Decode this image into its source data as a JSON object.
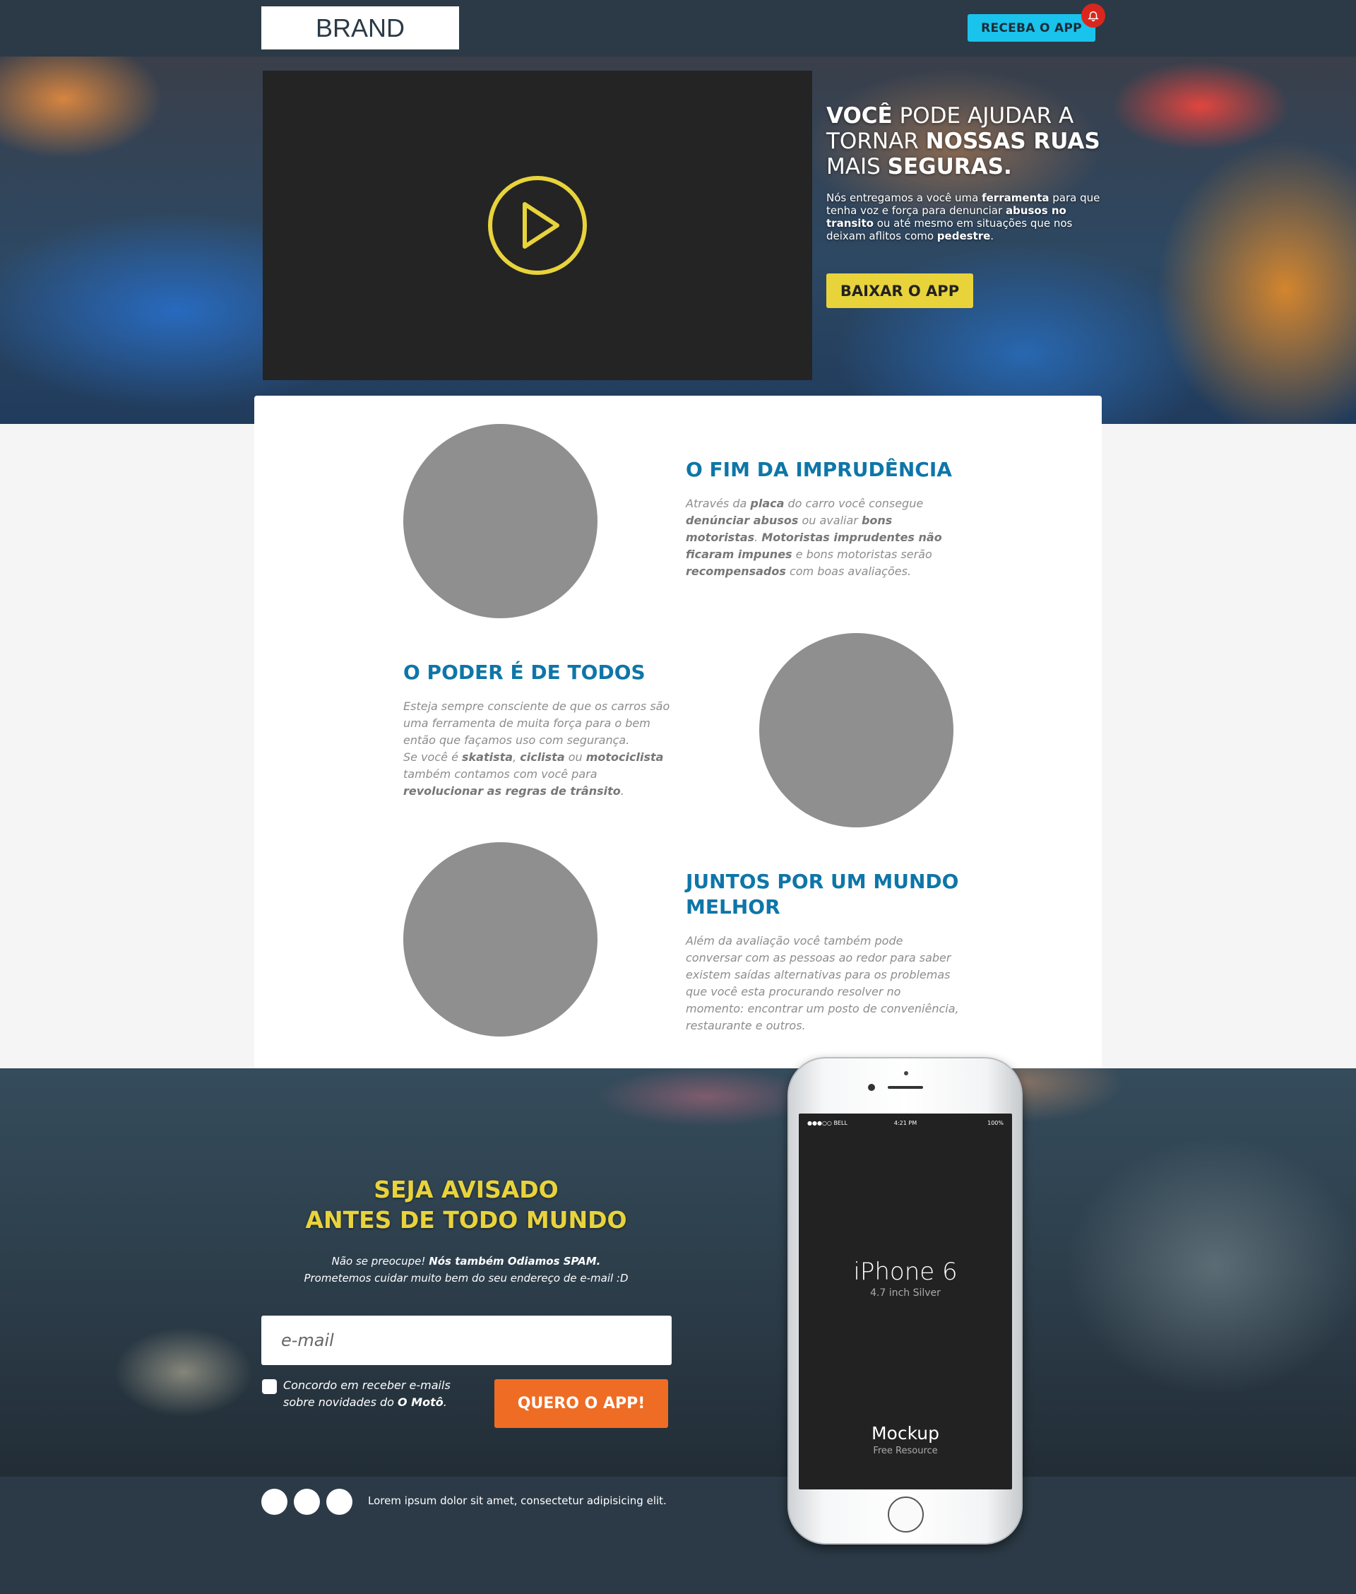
{
  "header": {
    "brand": "BRAND",
    "app_button": "RECEBA O APP"
  },
  "hero": {
    "title_line1_bold": "VOCÊ",
    "title_line1_rest": " PODE AJUDAR A",
    "title_line2_pre": "TORNAR ",
    "title_line2_bold": "NOSSAS RUAS",
    "title_line3_pre": "MAIS ",
    "title_line3_bold": "SEGURAS.",
    "text_1": "Nós entregamos a você uma ",
    "text_bold_1": "ferramenta",
    "text_2": " para que tenha voz e força para denunciar ",
    "text_bold_2": "abusos no transito",
    "text_3": " ou até mesmo em situações que nos deixam aflitos como ",
    "text_bold_3": "pedestre",
    "text_4": ".",
    "download_button": "BAIXAR O APP"
  },
  "features": [
    {
      "title": "O FIM DA IMPRUDÊNCIA",
      "segments": [
        {
          "t": "Através da ",
          "b": false
        },
        {
          "t": "placa",
          "b": true
        },
        {
          "t": " do carro você consegue ",
          "b": false
        },
        {
          "t": "denúnciar abusos",
          "b": true
        },
        {
          "t": " ou avaliar ",
          "b": false
        },
        {
          "t": "bons motoristas",
          "b": true
        },
        {
          "t": ". ",
          "b": false
        },
        {
          "t": "Motoristas imprudentes não ficaram impunes",
          "b": true
        },
        {
          "t": " e bons motoristas serão ",
          "b": false
        },
        {
          "t": "recompensados",
          "b": true
        },
        {
          "t": " com boas avaliações.",
          "b": false
        }
      ]
    },
    {
      "title": "O PODER É DE TODOS",
      "segments": [
        {
          "t": "Esteja sempre consciente de que os carros são uma ferramenta de muita força para o bem então que façamos uso com segurança.",
          "b": false
        },
        {
          "t": "\n",
          "b": false
        },
        {
          "t": "Se você é ",
          "b": false
        },
        {
          "t": "skatista",
          "b": true
        },
        {
          "t": ", ",
          "b": false
        },
        {
          "t": "ciclista",
          "b": true
        },
        {
          "t": " ou ",
          "b": false
        },
        {
          "t": "motociclista",
          "b": true
        },
        {
          "t": " também contamos com você para ",
          "b": false
        },
        {
          "t": "revolucionar as regras de trânsito",
          "b": true
        },
        {
          "t": ".",
          "b": false
        }
      ]
    },
    {
      "title": "JUNTOS POR UM MUNDO MELHOR",
      "segments": [
        {
          "t": "Além da avaliação você também pode conversar com as pessoas ao redor para saber existem saídas alternativas para os problemas que você esta procurando resolver no momento: encontrar um posto de conveniência, restaurante e outros.",
          "b": false
        }
      ]
    }
  ],
  "signup": {
    "title_line1": "SEJA AVISADO",
    "title_line2": "ANTES DE TODO MUNDO",
    "note_1": "Não se preocupe! ",
    "note_bold": "Nós também Odiamos SPAM.",
    "note_2": "Prometemos cuidar muito bem do seu endereço de e-mail :D",
    "email_placeholder": "e-mail",
    "agree_1": "Concordo em receber e-mails sobre novidades do ",
    "agree_bold": "O Motô",
    "agree_2": ".",
    "cta_button": "QUERO O APP!"
  },
  "phone": {
    "status_left": "●●●○○ BELL",
    "status_time": "4:21 PM",
    "status_right": "100%",
    "model": "iPhone 6",
    "model_sub": "4.7 inch Silver",
    "mockup_title": "Mockup",
    "mockup_sub": "Free Resource"
  },
  "footer": {
    "text": "Lorem ipsum dolor sit amet, consectetur adipisicing elit.",
    "social_icons": [
      "social-icon",
      "social-icon",
      "social-icon"
    ]
  },
  "colors": {
    "accent_yellow": "#e8d33b",
    "heading_blue": "#0e76a8",
    "cta_orange": "#ef6c24",
    "header_bg": "#2b3a46",
    "app_button_cyan": "#19c3ec",
    "notification_red": "#d9271e"
  }
}
